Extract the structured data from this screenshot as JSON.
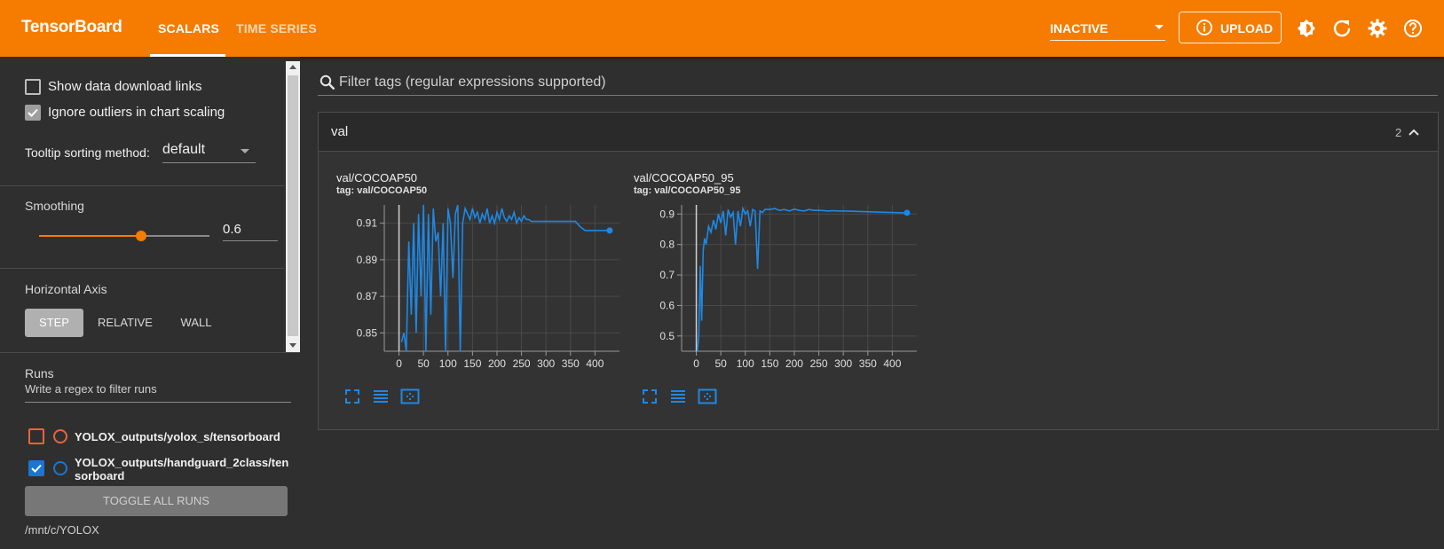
{
  "header": {
    "brand": "TensorBoard",
    "tabs": [
      {
        "label": "SCALARS"
      },
      {
        "label": "TIME SERIES"
      }
    ],
    "run_status": "INACTIVE",
    "upload_label": "UPLOAD",
    "accent_color": "#f57c00"
  },
  "sidebar": {
    "show_download_links": "Show data download links",
    "ignore_outliers": "Ignore outliers in chart scaling",
    "tooltip_sort_label": "Tooltip sorting method:",
    "tooltip_sort_value": "default",
    "smoothing_label": "Smoothing",
    "smoothing_value": "0.6",
    "smoothing_level": 0.6,
    "horizontal_axis_label": "Horizontal Axis",
    "axis_options": [
      "STEP",
      "RELATIVE",
      "WALL"
    ],
    "runs_label": "Runs",
    "runs_filter_placeholder": "Write a regex to filter runs",
    "runs": [
      {
        "name": "YOLOX_outputs/yolox_s/tensorboard",
        "checked": false,
        "color": "#e8643c"
      },
      {
        "name": "YOLOX_outputs/handguard_2class/tensorboard",
        "checked": true,
        "color": "#1976d2"
      }
    ],
    "toggle_all": "TOGGLE ALL RUNS",
    "logdir": "/mnt/c/YOLOX"
  },
  "main": {
    "filter_placeholder": "Filter tags (regular expressions supported)",
    "group": {
      "title": "val",
      "count": "2"
    }
  },
  "chart_data": [
    {
      "type": "line",
      "title": "val/COCOAP50",
      "subtitle": "tag: val/COCOAP50",
      "xlabel": "",
      "ylabel": "",
      "xlim": [
        -30,
        450
      ],
      "ylim": [
        0.84,
        0.92
      ],
      "xticks": [
        0,
        50,
        100,
        150,
        200,
        250,
        300,
        350,
        400
      ],
      "yticks": [
        0.85,
        0.87,
        0.89,
        0.91
      ],
      "grid": true,
      "series": [
        {
          "x": [
            5,
            10,
            15,
            20,
            25,
            30,
            35,
            40,
            45,
            50,
            55,
            60,
            65,
            70,
            75,
            80,
            85,
            90,
            95,
            100,
            105,
            110,
            115,
            120,
            125,
            130,
            135,
            140,
            145,
            150,
            155,
            160,
            165,
            170,
            175,
            180,
            185,
            190,
            195,
            200,
            205,
            210,
            215,
            220,
            225,
            230,
            235,
            240,
            245,
            250,
            255,
            260,
            265,
            270,
            275,
            280,
            285,
            290,
            295,
            300,
            310,
            320,
            330,
            340,
            350,
            360,
            370,
            380,
            390,
            400,
            410,
            420,
            430
          ],
          "y": [
            0.845,
            0.85,
            0.84,
            0.9,
            0.86,
            0.91,
            0.85,
            0.915,
            0.87,
            0.92,
            0.84,
            0.915,
            0.86,
            0.918,
            0.9,
            0.905,
            0.87,
            0.91,
            0.84,
            0.918,
            0.91,
            0.88,
            0.915,
            0.92,
            0.84,
            0.91,
            0.918,
            0.915,
            0.912,
            0.918,
            0.913,
            0.916,
            0.91,
            0.915,
            0.912,
            0.918,
            0.91,
            0.914,
            0.91,
            0.916,
            0.912,
            0.918,
            0.913,
            0.911,
            0.914,
            0.912,
            0.916,
            0.91,
            0.913,
            0.911,
            0.914,
            0.912,
            0.912,
            0.911,
            0.911,
            0.911,
            0.911,
            0.911,
            0.911,
            0.911,
            0.911,
            0.911,
            0.911,
            0.911,
            0.911,
            0.911,
            0.908,
            0.906,
            0.906,
            0.906,
            0.906,
            0.906,
            0.906
          ]
        }
      ]
    },
    {
      "type": "line",
      "title": "val/COCOAP50_95",
      "subtitle": "tag: val/COCOAP50_95",
      "xlabel": "",
      "ylabel": "",
      "xlim": [
        -30,
        450
      ],
      "ylim": [
        0.45,
        0.93
      ],
      "xticks": [
        0,
        50,
        100,
        150,
        200,
        250,
        300,
        350,
        400
      ],
      "yticks": [
        0.5,
        0.6,
        0.7,
        0.8,
        0.9
      ],
      "grid": true,
      "series": [
        {
          "x": [
            2,
            5,
            8,
            11,
            14,
            17,
            20,
            25,
            30,
            35,
            40,
            45,
            50,
            55,
            60,
            65,
            70,
            75,
            80,
            85,
            90,
            95,
            100,
            105,
            110,
            115,
            120,
            125,
            130,
            135,
            140,
            150,
            160,
            170,
            180,
            190,
            200,
            210,
            220,
            230,
            240,
            250,
            260,
            270,
            280,
            290,
            300,
            320,
            340,
            360,
            380,
            400,
            420,
            430
          ],
          "y": [
            0.45,
            0.5,
            0.73,
            0.55,
            0.78,
            0.82,
            0.8,
            0.86,
            0.84,
            0.88,
            0.85,
            0.9,
            0.87,
            0.91,
            0.83,
            0.915,
            0.89,
            0.905,
            0.8,
            0.91,
            0.86,
            0.918,
            0.9,
            0.91,
            0.86,
            0.915,
            0.91,
            0.72,
            0.91,
            0.905,
            0.915,
            0.915,
            0.918,
            0.912,
            0.915,
            0.91,
            0.916,
            0.912,
            0.91,
            0.915,
            0.912,
            0.912,
            0.911,
            0.91,
            0.911,
            0.91,
            0.91,
            0.909,
            0.908,
            0.907,
            0.906,
            0.905,
            0.904,
            0.904
          ]
        }
      ]
    }
  ]
}
